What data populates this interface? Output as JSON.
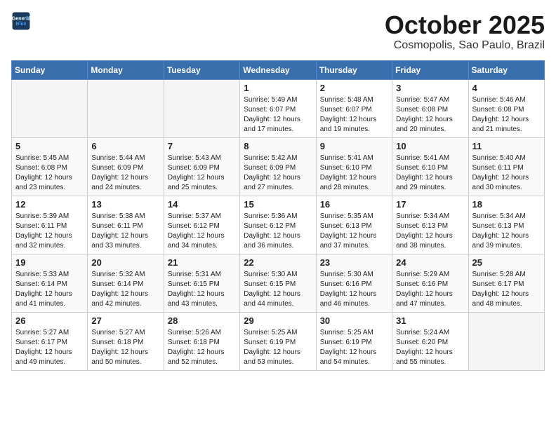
{
  "header": {
    "logo_line1": "General",
    "logo_line2": "Blue",
    "month_title": "October 2025",
    "subtitle": "Cosmopolis, Sao Paulo, Brazil"
  },
  "days_of_week": [
    "Sunday",
    "Monday",
    "Tuesday",
    "Wednesday",
    "Thursday",
    "Friday",
    "Saturday"
  ],
  "weeks": [
    [
      {
        "day": "",
        "empty": true
      },
      {
        "day": "",
        "empty": true
      },
      {
        "day": "",
        "empty": true
      },
      {
        "day": "1",
        "sunrise": "5:49 AM",
        "sunset": "6:07 PM",
        "daylight": "12 hours and 17 minutes."
      },
      {
        "day": "2",
        "sunrise": "5:48 AM",
        "sunset": "6:07 PM",
        "daylight": "12 hours and 19 minutes."
      },
      {
        "day": "3",
        "sunrise": "5:47 AM",
        "sunset": "6:08 PM",
        "daylight": "12 hours and 20 minutes."
      },
      {
        "day": "4",
        "sunrise": "5:46 AM",
        "sunset": "6:08 PM",
        "daylight": "12 hours and 21 minutes."
      }
    ],
    [
      {
        "day": "5",
        "sunrise": "5:45 AM",
        "sunset": "6:08 PM",
        "daylight": "12 hours and 23 minutes."
      },
      {
        "day": "6",
        "sunrise": "5:44 AM",
        "sunset": "6:09 PM",
        "daylight": "12 hours and 24 minutes."
      },
      {
        "day": "7",
        "sunrise": "5:43 AM",
        "sunset": "6:09 PM",
        "daylight": "12 hours and 25 minutes."
      },
      {
        "day": "8",
        "sunrise": "5:42 AM",
        "sunset": "6:09 PM",
        "daylight": "12 hours and 27 minutes."
      },
      {
        "day": "9",
        "sunrise": "5:41 AM",
        "sunset": "6:10 PM",
        "daylight": "12 hours and 28 minutes."
      },
      {
        "day": "10",
        "sunrise": "5:41 AM",
        "sunset": "6:10 PM",
        "daylight": "12 hours and 29 minutes."
      },
      {
        "day": "11",
        "sunrise": "5:40 AM",
        "sunset": "6:11 PM",
        "daylight": "12 hours and 30 minutes."
      }
    ],
    [
      {
        "day": "12",
        "sunrise": "5:39 AM",
        "sunset": "6:11 PM",
        "daylight": "12 hours and 32 minutes."
      },
      {
        "day": "13",
        "sunrise": "5:38 AM",
        "sunset": "6:11 PM",
        "daylight": "12 hours and 33 minutes."
      },
      {
        "day": "14",
        "sunrise": "5:37 AM",
        "sunset": "6:12 PM",
        "daylight": "12 hours and 34 minutes."
      },
      {
        "day": "15",
        "sunrise": "5:36 AM",
        "sunset": "6:12 PM",
        "daylight": "12 hours and 36 minutes."
      },
      {
        "day": "16",
        "sunrise": "5:35 AM",
        "sunset": "6:13 PM",
        "daylight": "12 hours and 37 minutes."
      },
      {
        "day": "17",
        "sunrise": "5:34 AM",
        "sunset": "6:13 PM",
        "daylight": "12 hours and 38 minutes."
      },
      {
        "day": "18",
        "sunrise": "5:34 AM",
        "sunset": "6:13 PM",
        "daylight": "12 hours and 39 minutes."
      }
    ],
    [
      {
        "day": "19",
        "sunrise": "5:33 AM",
        "sunset": "6:14 PM",
        "daylight": "12 hours and 41 minutes."
      },
      {
        "day": "20",
        "sunrise": "5:32 AM",
        "sunset": "6:14 PM",
        "daylight": "12 hours and 42 minutes."
      },
      {
        "day": "21",
        "sunrise": "5:31 AM",
        "sunset": "6:15 PM",
        "daylight": "12 hours and 43 minutes."
      },
      {
        "day": "22",
        "sunrise": "5:30 AM",
        "sunset": "6:15 PM",
        "daylight": "12 hours and 44 minutes."
      },
      {
        "day": "23",
        "sunrise": "5:30 AM",
        "sunset": "6:16 PM",
        "daylight": "12 hours and 46 minutes."
      },
      {
        "day": "24",
        "sunrise": "5:29 AM",
        "sunset": "6:16 PM",
        "daylight": "12 hours and 47 minutes."
      },
      {
        "day": "25",
        "sunrise": "5:28 AM",
        "sunset": "6:17 PM",
        "daylight": "12 hours and 48 minutes."
      }
    ],
    [
      {
        "day": "26",
        "sunrise": "5:27 AM",
        "sunset": "6:17 PM",
        "daylight": "12 hours and 49 minutes."
      },
      {
        "day": "27",
        "sunrise": "5:27 AM",
        "sunset": "6:18 PM",
        "daylight": "12 hours and 50 minutes."
      },
      {
        "day": "28",
        "sunrise": "5:26 AM",
        "sunset": "6:18 PM",
        "daylight": "12 hours and 52 minutes."
      },
      {
        "day": "29",
        "sunrise": "5:25 AM",
        "sunset": "6:19 PM",
        "daylight": "12 hours and 53 minutes."
      },
      {
        "day": "30",
        "sunrise": "5:25 AM",
        "sunset": "6:19 PM",
        "daylight": "12 hours and 54 minutes."
      },
      {
        "day": "31",
        "sunrise": "5:24 AM",
        "sunset": "6:20 PM",
        "daylight": "12 hours and 55 minutes."
      },
      {
        "day": "",
        "empty": true
      }
    ]
  ],
  "labels": {
    "sunrise_label": "Sunrise:",
    "sunset_label": "Sunset:",
    "daylight_label": "Daylight:"
  }
}
